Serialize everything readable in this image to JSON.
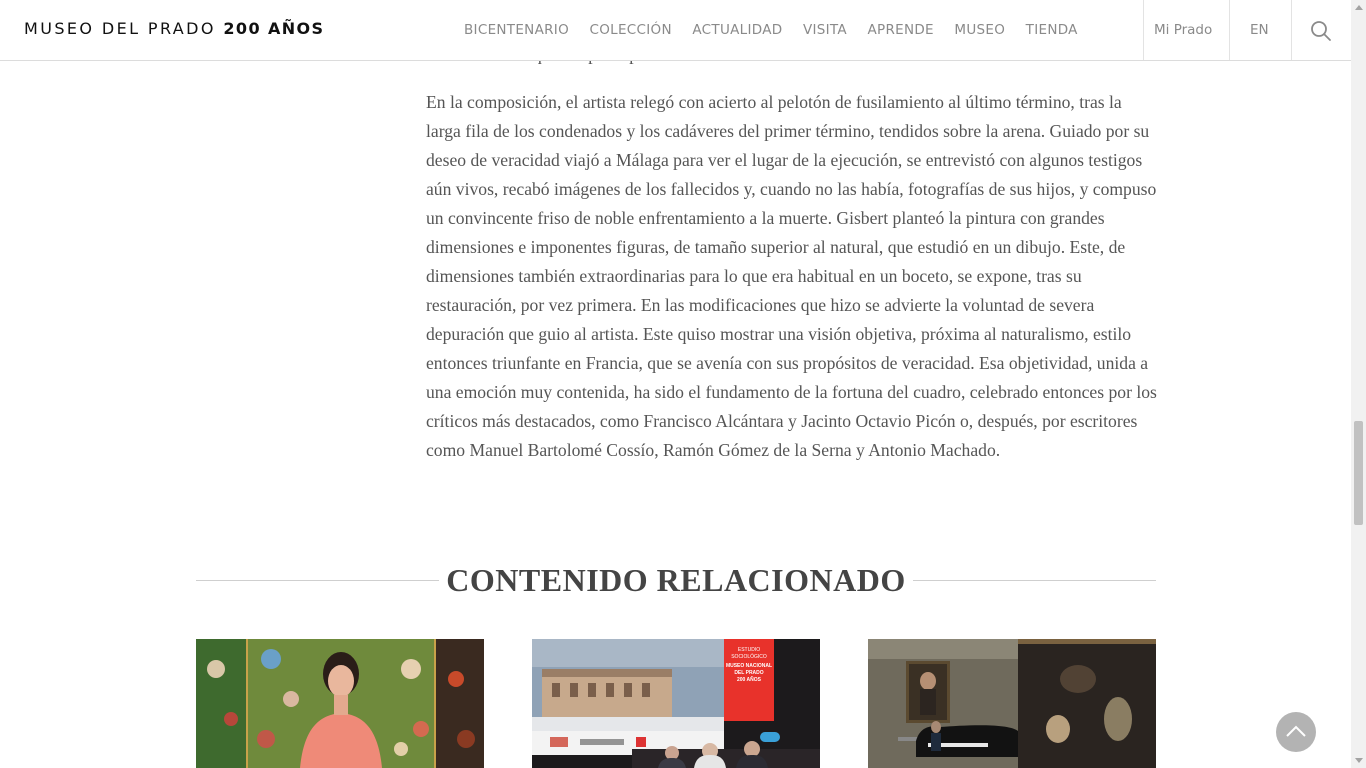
{
  "header": {
    "logo_regular": "MUSEO DEL PRADO",
    "logo_bold": "200 AÑOS",
    "nav": [
      "BICENTENARIO",
      "COLECCIÓN",
      "ACTUALIDAD",
      "VISITA",
      "APRENDE",
      "MUSEO",
      "TIENDA"
    ],
    "mi_prado": "Mi Prado",
    "lang": "EN",
    "search_icon": "search-icon"
  },
  "article": {
    "previous_fragment": "del triunfo de aquellos principios.",
    "paragraph": "En la composición, el artista relegó con acierto al pelotón de fusilamiento al último término, tras la larga fila de los condenados y los cadáveres del primer término, tendidos sobre la arena. Guiado por su deseo de veracidad viajó a Málaga para ver el lugar de la ejecución, se entrevistó con algunos testigos aún vivos, recabó imágenes de los fallecidos y, cuando no las había, fotografías de sus hijos, y compuso un convincente friso de noble enfrentamiento a la muerte. Gisbert planteó la pintura con grandes dimensiones e imponentes figuras, de tamaño superior al natural, que estudió en un dibujo. Este, de dimensiones también extraordinarias para lo que era habitual en un boceto, se expone, tras su restauración, por vez primera. En las modificaciones que hizo se advierte la voluntad de severa depuración que guio al artista. Este quiso mostrar una visión objetiva, próxima al naturalismo, estilo entonces triunfante en Francia, que se avenía con sus propósitos de veracidad. Esa objetividad, unida a una emoción muy contenida, ha sido el fundamento de la fortuna del cuadro, celebrado entonces por los críticos más destacados, como Francisco Alcántara y Jacinto Octavio Picón o, después, por escritores como Manuel Bartolomé Cossío, Ramón Gómez de la Serna y Antonio Machado."
  },
  "related": {
    "title": "CONTENIDO RELACIONADO",
    "card2_banner": [
      "ESTUDIO",
      "SOCIOLÓGICO",
      "MUSEO NACIONAL",
      "DEL PRADO",
      "200 AÑOS"
    ]
  },
  "colors": {
    "text": "#555555",
    "nav": "#8a8a8a",
    "banner_red": "#e8322b"
  }
}
